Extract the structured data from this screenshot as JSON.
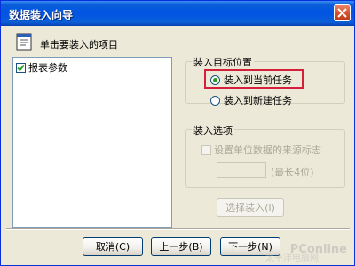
{
  "window": {
    "title": "数据装入向导",
    "instruction": "单击要装入的项目"
  },
  "list": {
    "items": [
      {
        "label": "报表参数",
        "checked": true
      }
    ]
  },
  "target_group": {
    "title": "装入目标位置",
    "options": [
      {
        "label": "装入到当前任务",
        "selected": true
      },
      {
        "label": "装入到新建任务",
        "selected": false
      }
    ]
  },
  "options_group": {
    "title": "装入选项",
    "checkbox_label": "设置单位数据的来源标志",
    "checkbox_checked": false,
    "length_hint": "(最长4位)",
    "select_button": "选择装入(I)"
  },
  "footer": {
    "cancel": "取消(C)",
    "back": "上一步(B)",
    "next": "下一步(N)"
  },
  "watermark": {
    "brand": "PConline",
    "sub": "太平洋电脑网"
  },
  "colors": {
    "titlebar": "#0054e3",
    "highlight": "#d4203a",
    "radio_dot": "#21a121",
    "face": "#ece9d8"
  }
}
